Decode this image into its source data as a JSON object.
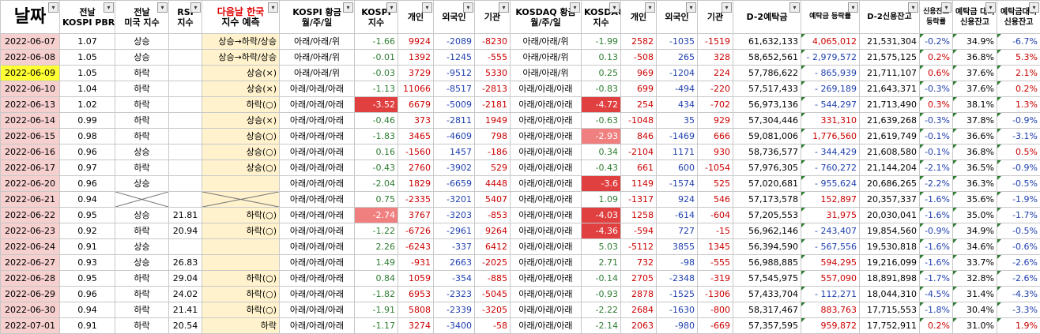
{
  "headers": {
    "date": "날짜",
    "pbr": [
      "전날",
      "KOSPI PBR"
    ],
    "us": [
      "전날",
      "미국 지수"
    ],
    "rsi": [
      "RSI",
      "지수"
    ],
    "pred": [
      "다음날 한국",
      "지수 예측"
    ],
    "kospi_pat": [
      "KOSPI 황금",
      "월/주/일"
    ],
    "kospi_idx": [
      "KOSPI",
      "지수"
    ],
    "kospi_ind": "개인",
    "kospi_for": "외국인",
    "kospi_ins": "기관",
    "kosdaq_pat": [
      "KOSDAQ 황금",
      "월/주/일"
    ],
    "kosdaq_idx": [
      "KOSDAQ",
      "지수"
    ],
    "kosdaq_ind": "개인",
    "kosdaq_for": "외국인",
    "kosdaq_ins": "기관",
    "deposit": "D-2예탁금",
    "dep_chg": "예탁금 등락률",
    "credit": "D-2신용잔고",
    "credit_chg": [
      "신용잔고",
      "등락률"
    ],
    "ratio": [
      "예탁금 대비",
      "신용잔고"
    ],
    "ratio_chg": [
      "예탁금대비",
      "신용잔고"
    ]
  },
  "colors": {
    "date_bg": "#f6cfcf",
    "date_highlight": "#ffff33",
    "pred_bg": "#fff2cc",
    "negative_fill": "#e04040",
    "neg_fill_light": "#f08080"
  },
  "rows": [
    {
      "date": "2022-06-07",
      "pbr": "1.07",
      "us": "상승",
      "rsi": "",
      "pred": "상승→하락/상승",
      "kp": "아래/아래/위",
      "ki": "-1.66",
      "i1": "9924",
      "f1": "-2089",
      "n1": "-8230",
      "qp": "아래/아래/위",
      "qi": "-1.99",
      "i2": "2582",
      "f2": "-1035",
      "n2": "-1519",
      "dep": "61,632,133",
      "dc": "4,065,012",
      "cr": "21,531,304",
      "crc": "-0.2%",
      "ra": "34.9%",
      "rac": "-6.7%"
    },
    {
      "date": "2022-06-08",
      "pbr": "1.05",
      "us": "상승",
      "rsi": "",
      "pred": "상승→하락/상승",
      "kp": "아래/아래/위",
      "ki": "-0.01",
      "i1": "1392",
      "f1": "-1245",
      "n1": "-555",
      "qp": "아래/아래/위",
      "qi": "0.13",
      "i2": "-508",
      "f2": "265",
      "n2": "328",
      "dep": "58,652,561",
      "dc": "- 2,979,572",
      "cr": "21,575,125",
      "crc": "0.2%",
      "ra": "36.8%",
      "rac": "5.3%"
    },
    {
      "date": "2022-06-09",
      "pbr": "1.05",
      "us": "하락",
      "rsi": "",
      "pred": "상승(×)",
      "kp": "아래/아래/위",
      "ki": "-0.03",
      "i1": "3729",
      "f1": "-9512",
      "n1": "5330",
      "qp": "아래/아래/위",
      "qi": "0.25",
      "i2": "969",
      "f2": "-1204",
      "n2": "224",
      "dep": "57,786,622",
      "dc": "- 865,939",
      "cr": "21,711,107",
      "crc": "0.6%",
      "ra": "37.6%",
      "rac": "2.1%"
    },
    {
      "date": "2022-06-10",
      "pbr": "1.04",
      "us": "하락",
      "rsi": "",
      "pred": "상승(×)",
      "kp": "아래/아래/아래",
      "ki": "-1.13",
      "i1": "11066",
      "f1": "-8517",
      "n1": "-2813",
      "qp": "아래/아래/아래",
      "qi": "-0.83",
      "i2": "699",
      "f2": "-494",
      "n2": "-220",
      "dep": "57,517,433",
      "dc": "- 269,189",
      "cr": "21,643,371",
      "crc": "-0.3%",
      "ra": "37.6%",
      "rac": "0.2%"
    },
    {
      "date": "2022-06-13",
      "pbr": "1.02",
      "us": "하락",
      "rsi": "",
      "pred": "하락(○)",
      "kp": "아래/아래/아래",
      "ki": "-3.52",
      "i1": "6679",
      "f1": "-5009",
      "n1": "-2181",
      "qp": "아래/아래/아래",
      "qi": "-4.72",
      "i2": "254",
      "f2": "434",
      "n2": "-702",
      "dep": "56,973,136",
      "dc": "- 544,297",
      "cr": "21,713,490",
      "crc": "0.3%",
      "ra": "38.1%",
      "rac": "1.3%"
    },
    {
      "date": "2022-06-14",
      "pbr": "0.99",
      "us": "하락",
      "rsi": "",
      "pred": "상승(×)",
      "kp": "아래/아래/아래",
      "ki": "-0.46",
      "i1": "373",
      "f1": "-2811",
      "n1": "1949",
      "qp": "아래/아래/아래",
      "qi": "-0.63",
      "i2": "-1048",
      "f2": "35",
      "n2": "929",
      "dep": "57,304,446",
      "dc": "331,310",
      "cr": "21,639,268",
      "crc": "-0.3%",
      "ra": "37.8%",
      "rac": "-0.9%"
    },
    {
      "date": "2022-06-15",
      "pbr": "0.98",
      "us": "하락",
      "rsi": "",
      "pred": "상승(○)",
      "kp": "아래/아래/아래",
      "ki": "-1.83",
      "i1": "3465",
      "f1": "-4609",
      "n1": "798",
      "qp": "아래/아래/아래",
      "qi": "-2.93",
      "i2": "846",
      "f2": "-1469",
      "n2": "666",
      "dep": "59,081,006",
      "dc": "1,776,560",
      "cr": "21,619,749",
      "crc": "-0.1%",
      "ra": "36.6%",
      "rac": "-3.1%"
    },
    {
      "date": "2022-06-16",
      "pbr": "0.96",
      "us": "상승",
      "rsi": "",
      "pred": "상승(○)",
      "kp": "아래/아래/아래",
      "ki": "0.16",
      "i1": "-1560",
      "f1": "1457",
      "n1": "-186",
      "qp": "아래/아래/아래",
      "qi": "0.34",
      "i2": "-2104",
      "f2": "1171",
      "n2": "930",
      "dep": "58,736,577",
      "dc": "- 344,429",
      "cr": "21,608,580",
      "crc": "-0.1%",
      "ra": "36.8%",
      "rac": "0.5%"
    },
    {
      "date": "2022-06-17",
      "pbr": "0.97",
      "us": "하락",
      "rsi": "",
      "pred": "상승(○)",
      "kp": "아래/아래/아래",
      "ki": "-0.43",
      "i1": "2760",
      "f1": "-3902",
      "n1": "529",
      "qp": "아래/아래/아래",
      "qi": "-0.43",
      "i2": "661",
      "f2": "600",
      "n2": "-1054",
      "dep": "57,976,305",
      "dc": "- 760,272",
      "cr": "21,144,204",
      "crc": "-2.1%",
      "ra": "36.5%",
      "rac": "-0.9%"
    },
    {
      "date": "2022-06-20",
      "pbr": "0.96",
      "us": "상승",
      "rsi": "",
      "pred": "",
      "kp": "아래/아래/아래",
      "ki": "-2.04",
      "i1": "1829",
      "f1": "-6659",
      "n1": "4448",
      "qp": "아래/아래/아래",
      "qi": "-3.6",
      "i2": "1149",
      "f2": "-1574",
      "n2": "525",
      "dep": "57,020,681",
      "dc": "- 955,624",
      "cr": "20,686,265",
      "crc": "-2.2%",
      "ra": "36.3%",
      "rac": "-0.5%"
    },
    {
      "date": "2022-06-21",
      "pbr": "0.94",
      "us": "",
      "rsi": "",
      "pred": "",
      "kp": "아래/아래/아래",
      "ki": "0.75",
      "i1": "-2335",
      "f1": "-3201",
      "n1": "5407",
      "qp": "아래/아래/아래",
      "qi": "1.09",
      "i2": "-1317",
      "f2": "924",
      "n2": "546",
      "dep": "57,173,578",
      "dc": "152,897",
      "cr": "20,357,337",
      "crc": "-1.6%",
      "ra": "35.6%",
      "rac": "-1.9%"
    },
    {
      "date": "2022-06-22",
      "pbr": "0.95",
      "us": "상승",
      "rsi": "21.81",
      "pred": "하락(○)",
      "kp": "아래/아래/아래",
      "ki": "-2.74",
      "i1": "3767",
      "f1": "-3203",
      "n1": "-853",
      "qp": "아래/아래/아래",
      "qi": "-4.03",
      "i2": "1258",
      "f2": "-614",
      "n2": "-604",
      "dep": "57,205,553",
      "dc": "31,975",
      "cr": "20,030,041",
      "crc": "-1.6%",
      "ra": "35.0%",
      "rac": "-1.7%"
    },
    {
      "date": "2022-06-23",
      "pbr": "0.92",
      "us": "하락",
      "rsi": "20.94",
      "pred": "하락(○)",
      "kp": "아래/아래/아래",
      "ki": "-1.22",
      "i1": "-6726",
      "f1": "-2961",
      "n1": "9264",
      "qp": "아래/아래/아래",
      "qi": "-4.36",
      "i2": "-594",
      "f2": "727",
      "n2": "-15",
      "dep": "56,962,146",
      "dc": "- 243,407",
      "cr": "19,854,560",
      "crc": "-0.9%",
      "ra": "34.9%",
      "rac": "-0.5%"
    },
    {
      "date": "2022-06-24",
      "pbr": "0.91",
      "us": "상승",
      "rsi": "",
      "pred": "",
      "kp": "아래/아래/아래",
      "ki": "2.26",
      "i1": "-6243",
      "f1": "-337",
      "n1": "6412",
      "qp": "아래/아래/아래",
      "qi": "5.03",
      "i2": "-5112",
      "f2": "3855",
      "n2": "1345",
      "dep": "56,394,590",
      "dc": "- 567,556",
      "cr": "19,530,818",
      "crc": "-1.6%",
      "ra": "34.6%",
      "rac": "-0.6%"
    },
    {
      "date": "2022-06-27",
      "pbr": "0.93",
      "us": "상승",
      "rsi": "26.83",
      "pred": "",
      "kp": "아래/아래/아래",
      "ki": "1.49",
      "i1": "-931",
      "f1": "2663",
      "n1": "-2025",
      "qp": "아래/아래/아래",
      "qi": "2.71",
      "i2": "732",
      "f2": "-98",
      "n2": "-555",
      "dep": "56,988,885",
      "dc": "594,295",
      "cr": "19,216,099",
      "crc": "-1.6%",
      "ra": "33.7%",
      "rac": "-2.6%"
    },
    {
      "date": "2022-06-28",
      "pbr": "0.95",
      "us": "하락",
      "rsi": "29.04",
      "pred": "하락(○)",
      "kp": "아래/아래/아래",
      "ki": "0.84",
      "i1": "1059",
      "f1": "-354",
      "n1": "-885",
      "qp": "아래/아래/아래",
      "qi": "-0.14",
      "i2": "2705",
      "f2": "-2348",
      "n2": "-319",
      "dep": "57,545,975",
      "dc": "557,090",
      "cr": "18,891,898",
      "crc": "-1.7%",
      "ra": "32.8%",
      "rac": "-2.6%"
    },
    {
      "date": "2022-06-29",
      "pbr": "0.96",
      "us": "하락",
      "rsi": "24.02",
      "pred": "하락(○)",
      "kp": "아래/아래/아래",
      "ki": "-1.82",
      "i1": "6953",
      "f1": "-2323",
      "n1": "-5045",
      "qp": "아래/아래/아래",
      "qi": "-0.93",
      "i2": "2878",
      "f2": "-1525",
      "n2": "-1306",
      "dep": "57,433,704",
      "dc": "- 112,271",
      "cr": "18,044,310",
      "crc": "-4.5%",
      "ra": "31.4%",
      "rac": "-4.3%"
    },
    {
      "date": "2022-06-30",
      "pbr": "0.94",
      "us": "하락",
      "rsi": "21.41",
      "pred": "하락(○)",
      "kp": "아래/아래/아래",
      "ki": "-1.91",
      "i1": "5808",
      "f1": "-2339",
      "n1": "-3205",
      "qp": "아래/아래/아래",
      "qi": "-2.22",
      "i2": "2684",
      "f2": "-1630",
      "n2": "-800",
      "dep": "58,317,467",
      "dc": "883,763",
      "cr": "17,715,553",
      "crc": "-1.8%",
      "ra": "30.4%",
      "rac": "-3.3%"
    },
    {
      "date": "2022-07-01",
      "pbr": "0.91",
      "us": "하락",
      "rsi": "20.54",
      "pred": "하락",
      "kp": "아래/아래/아래",
      "ki": "-1.17",
      "i1": "3274",
      "f1": "-3400",
      "n1": "-58",
      "qp": "아래/아래/아래",
      "qi": "-2.14",
      "i2": "2063",
      "f2": "-980",
      "n2": "-669",
      "dep": "57,357,595",
      "dc": "959,872",
      "cr": "17,752,911",
      "crc": "0.2%",
      "ra": "31.0%",
      "rac": "1.9%"
    }
  ]
}
